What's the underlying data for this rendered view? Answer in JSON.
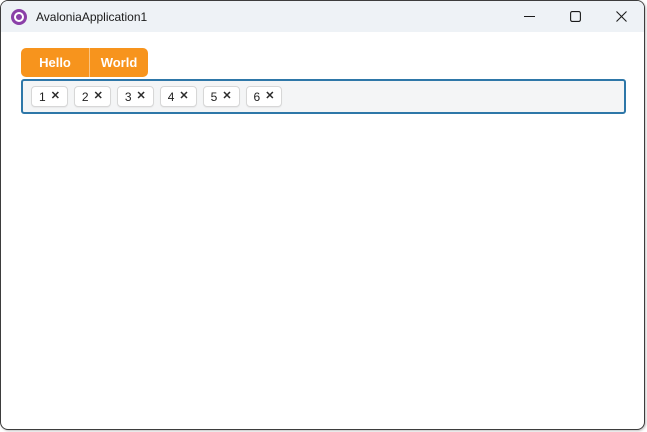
{
  "window": {
    "title": "AvaloniaApplication1",
    "titlebar_background": "#EEF2F6",
    "border_color": "#3D3D3D",
    "icon": "avalonia-logo-icon",
    "icon_color": "#8B3FA8",
    "controls": [
      "minimize",
      "maximize",
      "close"
    ]
  },
  "toolbar": {
    "hello_label": "Hello",
    "world_label": "World",
    "accent_color": "#F7941D",
    "text_color": "#FFFFFF"
  },
  "tag_input": {
    "tags": [
      "1",
      "2",
      "3",
      "4",
      "5",
      "6"
    ],
    "remove_glyph": "✕",
    "border_color": "#2E77A8",
    "background_color": "#F4F5F6",
    "tag_background": "#FFFFFF"
  }
}
